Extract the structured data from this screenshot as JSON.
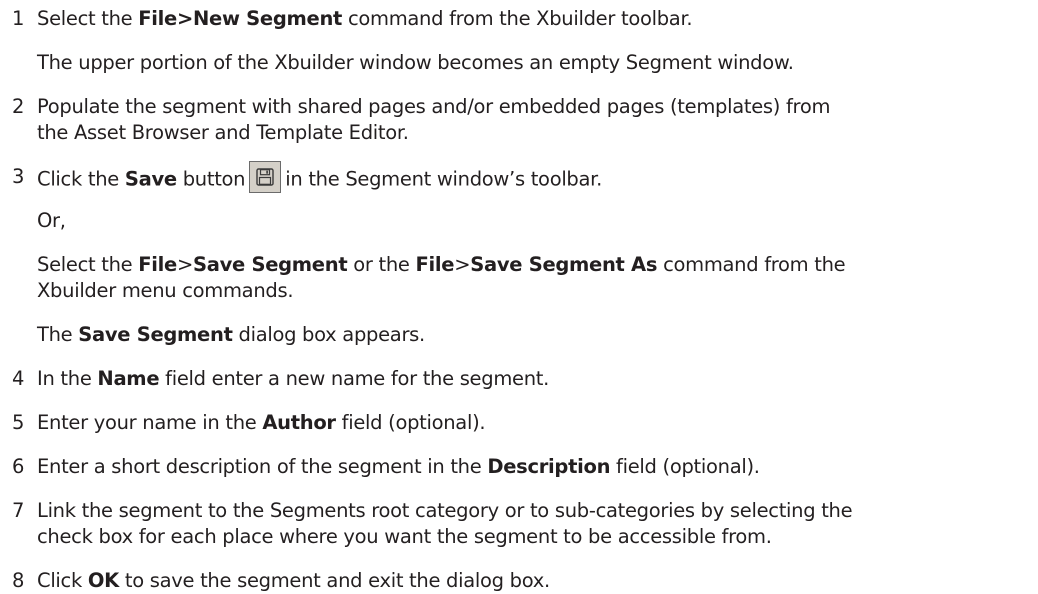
{
  "steps": [
    {
      "num": "1",
      "pre": "Select the ",
      "b1": "File",
      "mid": ">",
      "b2": "New Segment",
      "post": " command from the Xbuilder toolbar."
    },
    {
      "text": "The upper portion of the Xbuilder window becomes an empty Segment window."
    },
    {
      "num": "2",
      "text_a": "Populate the segment with shared pages and/or embedded pages (templates) from",
      "text_b": "the Asset Browser and Template Editor."
    },
    {
      "num": "3",
      "pre": "Click the ",
      "b1": "Save",
      "mid": " button",
      "post": "in the Segment window’s toolbar.",
      "icon": "save-icon"
    },
    {
      "text": "Or,"
    },
    {
      "pre": "Select the ",
      "b1": "File",
      "gt1": ">",
      "b2": "Save Segment",
      "or": " or the ",
      "b3": "File",
      "gt2": ">",
      "b4": "Save Segment As",
      "post": " command from the",
      "line2": "Xbuilder menu commands."
    },
    {
      "pre": "The ",
      "b1": "Save Segment",
      "post": " dialog box appears."
    },
    {
      "num": "4",
      "pre": "In the ",
      "b1": "Name",
      "post": " field enter a new name for the segment."
    },
    {
      "num": "5",
      "pre": "Enter your name in the ",
      "b1": "Author",
      "post": " field (optional)."
    },
    {
      "num": "6",
      "pre": "Enter a short description of the segment in the ",
      "b1": "Description",
      "post": " field (optional)."
    },
    {
      "num": "7",
      "text_a": "Link the segment to the Segments root category or to sub-categories by selecting the",
      "text_b": "check box for each place where you want the segment to be accessible from."
    },
    {
      "num": "8",
      "pre": "Click ",
      "b1": "OK",
      "post": " to save the segment and exit the dialog box."
    }
  ]
}
